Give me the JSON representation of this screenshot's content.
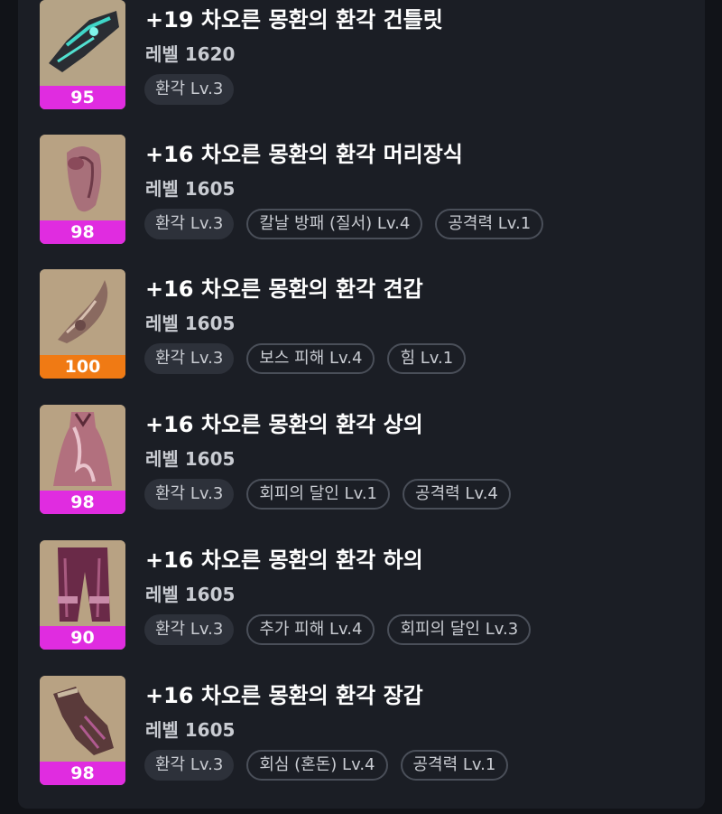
{
  "colors": {
    "quality_magenta": "#e02ce0",
    "quality_orange": "#f07a14"
  },
  "items": [
    {
      "title": "+19 차오른 몽환의 환각 건틀릿",
      "level": "레벨 1620",
      "quality": "95",
      "quality_color": "#e02ce0",
      "icon": "weapon-gauntlet-icon",
      "tags": [
        "환각 Lv.3"
      ]
    },
    {
      "title": "+16 차오른 몽환의 환각 머리장식",
      "level": "레벨 1605",
      "quality": "98",
      "quality_color": "#e02ce0",
      "icon": "helmet-icon",
      "tags": [
        "환각 Lv.3",
        "칼날 방패 (질서) Lv.4",
        "공격력 Lv.1"
      ]
    },
    {
      "title": "+16 차오른 몽환의 환각 견갑",
      "level": "레벨 1605",
      "quality": "100",
      "quality_color": "#f07a14",
      "icon": "shoulder-icon",
      "tags": [
        "환각 Lv.3",
        "보스 피해 Lv.4",
        "힘 Lv.1"
      ]
    },
    {
      "title": "+16 차오른 몽환의 환각 상의",
      "level": "레벨 1605",
      "quality": "98",
      "quality_color": "#e02ce0",
      "icon": "chest-armor-icon",
      "tags": [
        "환각 Lv.3",
        "회피의 달인 Lv.1",
        "공격력 Lv.4"
      ]
    },
    {
      "title": "+16 차오른 몽환의 환각 하의",
      "level": "레벨 1605",
      "quality": "90",
      "quality_color": "#e02ce0",
      "icon": "pants-icon",
      "tags": [
        "환각 Lv.3",
        "추가 피해 Lv.4",
        "회피의 달인 Lv.3"
      ]
    },
    {
      "title": "+16 차오른 몽환의 환각 장갑",
      "level": "레벨 1605",
      "quality": "98",
      "quality_color": "#e02ce0",
      "icon": "gloves-icon",
      "tags": [
        "환각 Lv.3",
        "회심 (혼돈) Lv.4",
        "공격력 Lv.1"
      ]
    }
  ]
}
